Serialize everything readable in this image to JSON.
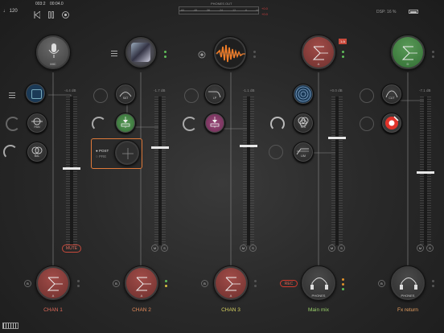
{
  "topbar": {
    "tempo": "♩ 120",
    "pos_a": "003:2",
    "pos_b": "00:04.0",
    "phones_label": "PHONES OUT",
    "meter_ticks": [
      "-60",
      "-48",
      "-36",
      "-24",
      "-12",
      "-6",
      "+0"
    ],
    "peak_a": "+0.0",
    "peak_b": "+0.0",
    "dsp": "DSP: 16 %"
  },
  "channels": [
    {
      "name": "CHAN 1",
      "input": "MIC",
      "fx": [
        "",
        "PAN",
        "BAL"
      ],
      "db": "-4.4 dB",
      "mute": "MUTE",
      "out": "A",
      "color": "#e06a5a"
    },
    {
      "name": "CHAN 2",
      "input": "",
      "fx": [
        "SAT",
        "D",
        ""
      ],
      "db": "-1.7 dB",
      "out": "A",
      "color": "#e38a5a"
    },
    {
      "name": "CHAN 3",
      "input": "",
      "fx": [
        "LP",
        "H"
      ],
      "db": "-1.1 dB",
      "out": "A",
      "color": "#d6d060"
    },
    {
      "name": "Main mix",
      "input": "A",
      "fx": [
        "",
        "M/S",
        "LIM"
      ],
      "db": "+0.0 dB",
      "rec": "REC",
      "out": "PHONES",
      "color": "#9ad06a"
    },
    {
      "name": "Fx return",
      "input": "D",
      "fx": [
        "CUT",
        ""
      ],
      "db": "-7.1 dB",
      "out": "PHONES",
      "color": "#e8a060"
    }
  ],
  "send_popup": {
    "post": "POST",
    "pre": "PRE"
  },
  "ms": {
    "m": "M",
    "s": "S"
  },
  "badge": "1:A",
  "colors": {
    "accent_red": "#c84a3c",
    "rec_red": "#d23a2e",
    "green": "#5fbb5a",
    "orange": "#f07d28"
  }
}
